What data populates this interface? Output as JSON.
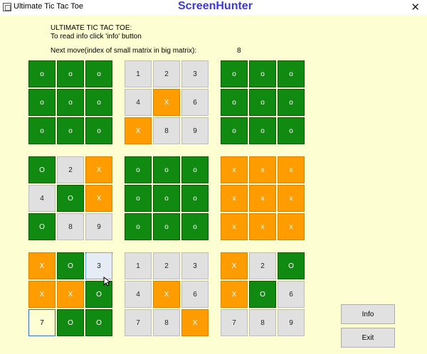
{
  "window": {
    "title": "Ultimate Tic Tac Toe",
    "watermark": "ScreenHunter",
    "close_glyph": "✕"
  },
  "header": {
    "line1": "ULTIMATE TIC TAC TOE:",
    "line2": "To read info click 'info' button",
    "next_move_label": "Next move(index of small matrix in big matrix):",
    "next_move_value": "8"
  },
  "colors": {
    "green": "#108a10",
    "orange": "#ff9c00",
    "empty": "#e0e0e0",
    "background": "#fdfed2"
  },
  "boards": [
    {
      "cells": [
        {
          "t": "o",
          "s": "g"
        },
        {
          "t": "o",
          "s": "g"
        },
        {
          "t": "o",
          "s": "g"
        },
        {
          "t": "o",
          "s": "g"
        },
        {
          "t": "o",
          "s": "g"
        },
        {
          "t": "o",
          "s": "g"
        },
        {
          "t": "o",
          "s": "g"
        },
        {
          "t": "o",
          "s": "g"
        },
        {
          "t": "o",
          "s": "g"
        }
      ]
    },
    {
      "cells": [
        {
          "t": "1",
          "s": "n"
        },
        {
          "t": "2",
          "s": "n"
        },
        {
          "t": "3",
          "s": "n"
        },
        {
          "t": "4",
          "s": "n"
        },
        {
          "t": "X",
          "s": "o"
        },
        {
          "t": "6",
          "s": "n"
        },
        {
          "t": "X",
          "s": "o"
        },
        {
          "t": "8",
          "s": "n"
        },
        {
          "t": "9",
          "s": "n"
        }
      ]
    },
    {
      "cells": [
        {
          "t": "o",
          "s": "g"
        },
        {
          "t": "o",
          "s": "g"
        },
        {
          "t": "o",
          "s": "g"
        },
        {
          "t": "o",
          "s": "g"
        },
        {
          "t": "o",
          "s": "g"
        },
        {
          "t": "o",
          "s": "g"
        },
        {
          "t": "o",
          "s": "g"
        },
        {
          "t": "o",
          "s": "g"
        },
        {
          "t": "o",
          "s": "g"
        }
      ]
    },
    {
      "cells": [
        {
          "t": "O",
          "s": "g"
        },
        {
          "t": "2",
          "s": "n"
        },
        {
          "t": "X",
          "s": "o"
        },
        {
          "t": "4",
          "s": "n"
        },
        {
          "t": "O",
          "s": "g"
        },
        {
          "t": "X",
          "s": "o"
        },
        {
          "t": "O",
          "s": "g"
        },
        {
          "t": "8",
          "s": "n"
        },
        {
          "t": "9",
          "s": "n"
        }
      ]
    },
    {
      "cells": [
        {
          "t": "o",
          "s": "g"
        },
        {
          "t": "o",
          "s": "g"
        },
        {
          "t": "o",
          "s": "g"
        },
        {
          "t": "o",
          "s": "g"
        },
        {
          "t": "o",
          "s": "g"
        },
        {
          "t": "o",
          "s": "g"
        },
        {
          "t": "o",
          "s": "g"
        },
        {
          "t": "o",
          "s": "g"
        },
        {
          "t": "o",
          "s": "g"
        }
      ]
    },
    {
      "cells": [
        {
          "t": "x",
          "s": "o"
        },
        {
          "t": "x",
          "s": "o"
        },
        {
          "t": "x",
          "s": "o"
        },
        {
          "t": "x",
          "s": "o"
        },
        {
          "t": "x",
          "s": "o"
        },
        {
          "t": "x",
          "s": "o"
        },
        {
          "t": "x",
          "s": "o"
        },
        {
          "t": "x",
          "s": "o"
        },
        {
          "t": "x",
          "s": "o"
        }
      ]
    },
    {
      "cells": [
        {
          "t": "X",
          "s": "o"
        },
        {
          "t": "O",
          "s": "g"
        },
        {
          "t": "3",
          "s": "sel"
        },
        {
          "t": "X",
          "s": "o"
        },
        {
          "t": "X",
          "s": "o"
        },
        {
          "t": "O",
          "s": "g"
        },
        {
          "t": "7",
          "s": "focus"
        },
        {
          "t": "O",
          "s": "g"
        },
        {
          "t": "O",
          "s": "g"
        }
      ]
    },
    {
      "cells": [
        {
          "t": "1",
          "s": "n"
        },
        {
          "t": "2",
          "s": "n"
        },
        {
          "t": "3",
          "s": "n"
        },
        {
          "t": "4",
          "s": "n"
        },
        {
          "t": "X",
          "s": "o"
        },
        {
          "t": "6",
          "s": "n"
        },
        {
          "t": "7",
          "s": "n"
        },
        {
          "t": "8",
          "s": "n"
        },
        {
          "t": "X",
          "s": "o"
        }
      ]
    },
    {
      "cells": [
        {
          "t": "X",
          "s": "o"
        },
        {
          "t": "2",
          "s": "n"
        },
        {
          "t": "O",
          "s": "g"
        },
        {
          "t": "X",
          "s": "o"
        },
        {
          "t": "O",
          "s": "g"
        },
        {
          "t": "6",
          "s": "n"
        },
        {
          "t": "7",
          "s": "n"
        },
        {
          "t": "8",
          "s": "n"
        },
        {
          "t": "9",
          "s": "n"
        }
      ]
    }
  ],
  "buttons": {
    "info": "Info",
    "exit": "Exit"
  }
}
